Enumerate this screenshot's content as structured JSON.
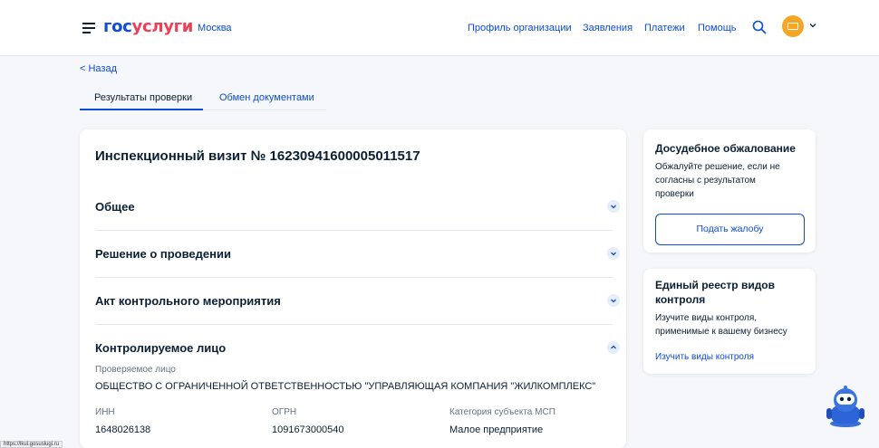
{
  "header": {
    "logo_part1": "гос",
    "logo_part2": "услуги",
    "city": "Москва",
    "nav": [
      "Профиль организации",
      "Заявления",
      "Платежи",
      "Помощь"
    ]
  },
  "back_label": "< Назад",
  "tabs": [
    {
      "label": "Результаты проверки",
      "active": true
    },
    {
      "label": "Обмен документами",
      "active": false
    }
  ],
  "inspection": {
    "title": "Инспекционный визит № 16230941600005011517",
    "sections": [
      {
        "label": "Общее",
        "expanded": false
      },
      {
        "label": "Решение о проведении",
        "expanded": false
      },
      {
        "label": "Акт контрольного мероприятия",
        "expanded": false
      },
      {
        "label": "Контролируемое лицо",
        "expanded": true
      }
    ],
    "controlled_person": {
      "entity_label": "Проверяемое лицо",
      "entity_value": "ОБЩЕСТВО С ОГРАНИЧЕННОЙ ОТВЕТСТВЕННОСТЬЮ \"УПРАВЛЯЮЩАЯ КОМПАНИЯ \"ЖИЛКОМПЛЕКС\"",
      "inn_label": "ИНН",
      "inn_value": "1648026138",
      "ogrn_label": "ОГРН",
      "ogrn_value": "1091673000540",
      "msp_label": "Категория субъекта МСП",
      "msp_value": "Малое предприятие"
    }
  },
  "appeal": {
    "title": "Досудебное обжалование",
    "line1": "Обжалуйте решение, если не",
    "line2": "согласны с результатом",
    "line3": "проверки",
    "button": "Подать жалобу"
  },
  "registry": {
    "title_line1": "Единый реестр видов",
    "title_line2": "контроля",
    "line1": "Изучите виды контроля,",
    "line2": "применимые к вашему бизнесу",
    "link": "Изучить виды контроля"
  },
  "status_url": "https://lkul.gosuslugi.ru",
  "colors": {
    "accent": "#0d4cd3",
    "brand_red": "#ee3f58",
    "text": "#0b1f33",
    "muted": "#66727f",
    "avatar": "#f5a623"
  }
}
